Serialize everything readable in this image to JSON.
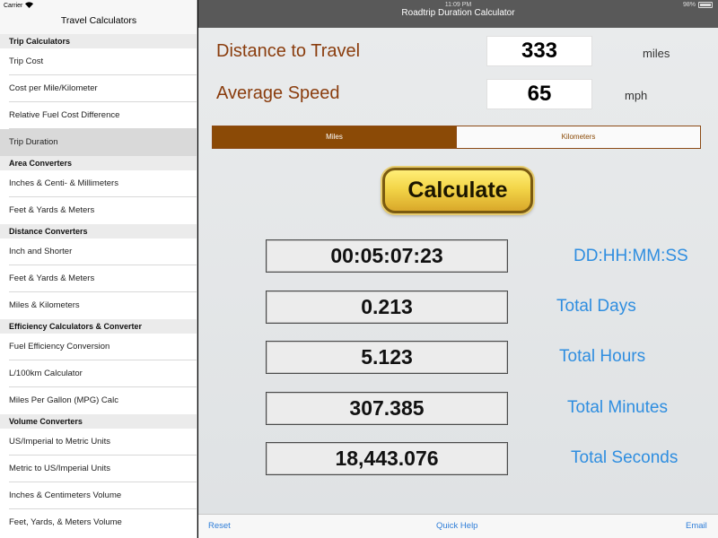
{
  "status": {
    "carrier": "Carrier",
    "time": "11:09 PM",
    "battery": "98%"
  },
  "sidebar": {
    "title": "Travel Calculators",
    "sections": [
      {
        "header": "Trip Calculators",
        "items": [
          "Trip Cost",
          "Cost per Mile/Kilometer",
          "Relative Fuel Cost Difference",
          "Trip Duration"
        ]
      },
      {
        "header": "Area Converters",
        "items": [
          "Inches & Centi- & Millimeters",
          "Feet & Yards & Meters"
        ]
      },
      {
        "header": "Distance Converters",
        "items": [
          "Inch and Shorter",
          "Feet & Yards & Meters",
          "Miles & Kilometers"
        ]
      },
      {
        "header": "Efficiency Calculators & Converter",
        "items": [
          "Fuel Efficiency Conversion",
          "L/100km Calculator",
          "Miles Per Gallon (MPG) Calc"
        ]
      },
      {
        "header": "Volume Converters",
        "items": [
          "US/Imperial to Metric Units",
          "Metric to US/Imperial Units",
          "Inches & Centimeters Volume",
          "Feet, Yards, & Meters Volume"
        ]
      }
    ],
    "selected_item": "Trip Duration"
  },
  "navbar": {
    "title": "Roadtrip Duration Calculator"
  },
  "inputs": {
    "distance": {
      "label": "Distance to Travel",
      "value": "333",
      "unit": "miles"
    },
    "speed": {
      "label": "Average Speed",
      "value": "65",
      "unit": "mph"
    }
  },
  "segmented": {
    "options": [
      "Miles",
      "Kilometers"
    ],
    "selected": "Miles"
  },
  "calculate_label": "Calculate",
  "results": [
    {
      "value": "00:05:07:23",
      "label": "DD:HH:MM:SS"
    },
    {
      "value": "0.213",
      "label": "Total Days"
    },
    {
      "value": "5.123",
      "label": "Total Hours"
    },
    {
      "value": "307.385",
      "label": "Total Minutes"
    },
    {
      "value": "18,443.076",
      "label": "Total Seconds"
    }
  ],
  "toolbar": {
    "reset": "Reset",
    "quick_help": "Quick Help",
    "email": "Email"
  },
  "colors": {
    "accent_brown": "#8b4a06",
    "result_blue": "#2f8ee0",
    "link_blue": "#2f7ed8",
    "navbar": "#595959"
  }
}
